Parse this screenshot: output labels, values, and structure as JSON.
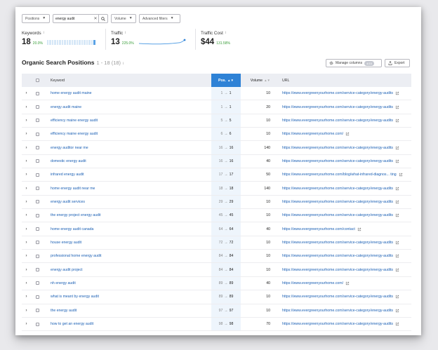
{
  "filters": {
    "positions_label": "Positions",
    "search_value": "energy audit",
    "volume_label": "Volume",
    "advanced_label": "Advanced filters"
  },
  "metrics": {
    "keywords": {
      "label": "Keywords",
      "value": "18",
      "delta": "20.0%"
    },
    "traffic": {
      "label": "Traffic",
      "value": "13",
      "delta": "225.0%"
    },
    "traffic_cost": {
      "label": "Traffic Cost",
      "value": "$44",
      "delta": "131.58%"
    }
  },
  "colors": {
    "accent": "#2e82d6",
    "link": "#1a5fb4",
    "positive": "#3a9e3a"
  },
  "section": {
    "title": "Organic Search Positions",
    "count": "1 - 18 (18)",
    "manage_columns_label": "Manage columns",
    "manage_columns_badge": "4/15",
    "export_label": "Export"
  },
  "table": {
    "headers": {
      "keyword": "Keyword",
      "pos": "Pos.",
      "volume": "Volume",
      "url": "URL"
    },
    "rows": [
      {
        "keyword": "home energy audit maine",
        "pos_from": "1",
        "pos_to": "1",
        "volume": "10",
        "url": "https://www.evergreenyourhome.com/service-category/energy-audits"
      },
      {
        "keyword": "energy audit maine",
        "pos_from": "1",
        "pos_to": "1",
        "volume": "20",
        "url": "https://www.evergreenyourhome.com/service-category/energy-audits"
      },
      {
        "keyword": "efficiency maine energy audit",
        "pos_from": "5",
        "pos_to": "5",
        "volume": "10",
        "url": "https://www.evergreenyourhome.com/service-category/energy-audits"
      },
      {
        "keyword": "efficiency maine energy audit",
        "pos_from": "6",
        "pos_to": "6",
        "volume": "10",
        "url": "https://www.evergreenyourhome.com/"
      },
      {
        "keyword": "energy auditor near me",
        "pos_from": "16",
        "pos_to": "16",
        "volume": "140",
        "url": "https://www.evergreenyourhome.com/service-category/energy-audits"
      },
      {
        "keyword": "domestic energy audit",
        "pos_from": "16",
        "pos_to": "16",
        "volume": "40",
        "url": "https://www.evergreenyourhome.com/service-category/energy-audits"
      },
      {
        "keyword": "infrared energy audit",
        "pos_from": "17",
        "pos_to": "17",
        "volume": "50",
        "url": "https://www.evergreenyourhome.com/blog/what-infrared-diagnos... ting"
      },
      {
        "keyword": "home energy audit near me",
        "pos_from": "18",
        "pos_to": "18",
        "volume": "140",
        "url": "https://www.evergreenyourhome.com/service-category/energy-audits"
      },
      {
        "keyword": "energy audit services",
        "pos_from": "29",
        "pos_to": "29",
        "volume": "10",
        "url": "https://www.evergreenyourhome.com/service-category/energy-audits"
      },
      {
        "keyword": "the energy project energy audit",
        "pos_from": "45",
        "pos_to": "45",
        "volume": "10",
        "url": "https://www.evergreenyourhome.com/service-category/energy-audits"
      },
      {
        "keyword": "home energy audit canada",
        "pos_from": "64",
        "pos_to": "64",
        "volume": "40",
        "url": "https://www.evergreenyourhome.com/contact"
      },
      {
        "keyword": "house energy audit",
        "pos_from": "72",
        "pos_to": "72",
        "volume": "10",
        "url": "https://www.evergreenyourhome.com/service-category/energy-audits"
      },
      {
        "keyword": "professional home energy audit",
        "pos_from": "84",
        "pos_to": "84",
        "volume": "10",
        "url": "https://www.evergreenyourhome.com/service-category/energy-audits"
      },
      {
        "keyword": "energy audit project",
        "pos_from": "84",
        "pos_to": "84",
        "volume": "10",
        "url": "https://www.evergreenyourhome.com/service-category/energy-audits"
      },
      {
        "keyword": "nh energy audit",
        "pos_from": "89",
        "pos_to": "89",
        "volume": "40",
        "url": "https://www.evergreenyourhome.com/"
      },
      {
        "keyword": "what is meant by energy audit",
        "pos_from": "89",
        "pos_to": "89",
        "volume": "10",
        "url": "https://www.evergreenyourhome.com/service-category/energy-audits"
      },
      {
        "keyword": "the energy audit",
        "pos_from": "97",
        "pos_to": "97",
        "volume": "10",
        "url": "https://www.evergreenyourhome.com/service-category/energy-audits"
      },
      {
        "keyword": "how to get an energy audit",
        "pos_from": "98",
        "pos_to": "98",
        "volume": "70",
        "url": "https://www.evergreenyourhome.com/service-category/energy-audits"
      }
    ]
  }
}
